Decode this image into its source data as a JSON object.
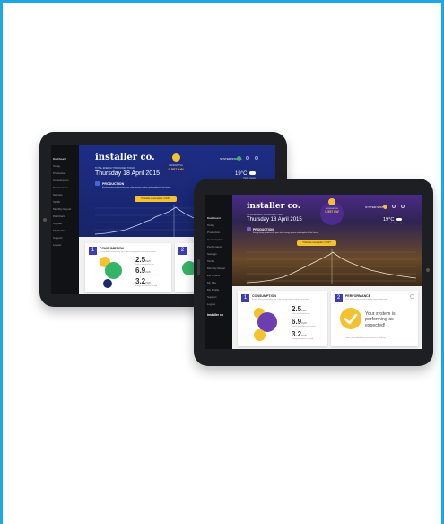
{
  "brand": "installer co.",
  "date_caption": "TOTAL ENERGY PRODUCED TODAY",
  "date": "Thursday 18 April 2015",
  "badge": {
    "label": "GENERATING",
    "value": "0.557 kW",
    "caption": "Average power now"
  },
  "system_status": "SYSTEM STATUS",
  "weather": {
    "temp": "19°C",
    "caption": "Partly cloudy"
  },
  "production": {
    "title": "PRODUCTION",
    "desc": "Energy being produced by your solar energy system and supplied to the home"
  },
  "cta": "TOGGLE consumption / COST",
  "sidebar": [
    "Dashboard",
    "Today",
    "Production",
    "Consumption",
    "Performance",
    "Savings",
    "Tariffs",
    "Monthly Report",
    "kW Charts",
    "My Site",
    "My Profile",
    "Support",
    "Logout"
  ],
  "sidebar_logo": "installer co",
  "consumption": {
    "number": "1",
    "title": "CONSUMPTION",
    "desc": "Energy being produced by your solar energy system and how it is used",
    "stats": [
      {
        "value": "2.5",
        "unit": "kWh",
        "caption": "Solar consumed on site"
      },
      {
        "value": "6.9",
        "unit": "kWh",
        "caption": "Energy imported from the grid"
      },
      {
        "value": "3.2",
        "unit": "kWh",
        "caption": "Energy exported to the grid"
      }
    ]
  },
  "performance": {
    "number": "2",
    "title": "PERFORMANCE",
    "desc": "Your solar energy system is performing as expected",
    "message": "Your system is performing as expected!",
    "footer": "Learn more about how your system is working"
  },
  "colors": {
    "frame": "#1ea7e4",
    "bezel": "#1e1f22",
    "hero_back": "#1b2a7a",
    "accent": "#f4c131",
    "green": "#35b366",
    "purple": "#6b3fb0",
    "navy": "#1b2a6b"
  }
}
